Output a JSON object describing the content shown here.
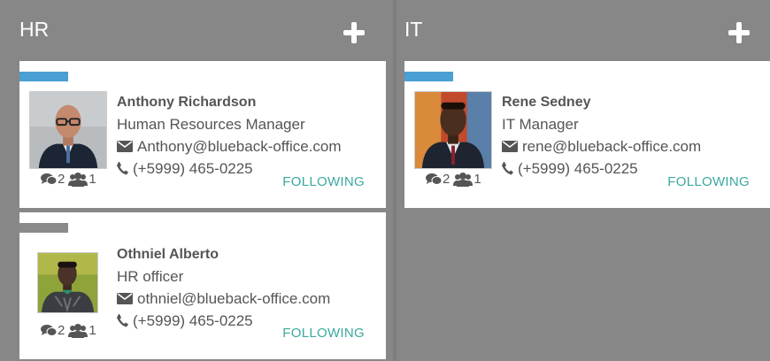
{
  "colors": {
    "accent_blue": "#4a9fd4",
    "accent_gray": "#8a8a8a",
    "following_teal": "#3aa99f"
  },
  "columns": [
    {
      "title": "HR",
      "cards": [
        {
          "name": "Anthony Richardson",
          "title": "Human Resources Manager",
          "email": "Anthony@blueback-office.com",
          "phone": "(+5999) 465-0225",
          "comments": "2",
          "followers": "1",
          "follow_label": "FOLLOWING",
          "accent": "blue",
          "photo_icon": "portrait-photo"
        },
        {
          "name": "Othniel Alberto",
          "title": "HR officer",
          "email": "othniel@blueback-office.com",
          "phone": "(+5999) 465-0225",
          "comments": "2",
          "followers": "1",
          "follow_label": "FOLLOWING",
          "accent": "gray",
          "photo_icon": "portrait-photo"
        }
      ]
    },
    {
      "title": "IT",
      "cards": [
        {
          "name": "Rene Sedney",
          "title": "IT Manager",
          "email": "rene@blueback-office.com",
          "phone": "(+5999) 465-0225",
          "comments": "2",
          "followers": "1",
          "follow_label": "FOLLOWING",
          "accent": "blue",
          "photo_icon": "portrait-photo"
        }
      ]
    }
  ]
}
